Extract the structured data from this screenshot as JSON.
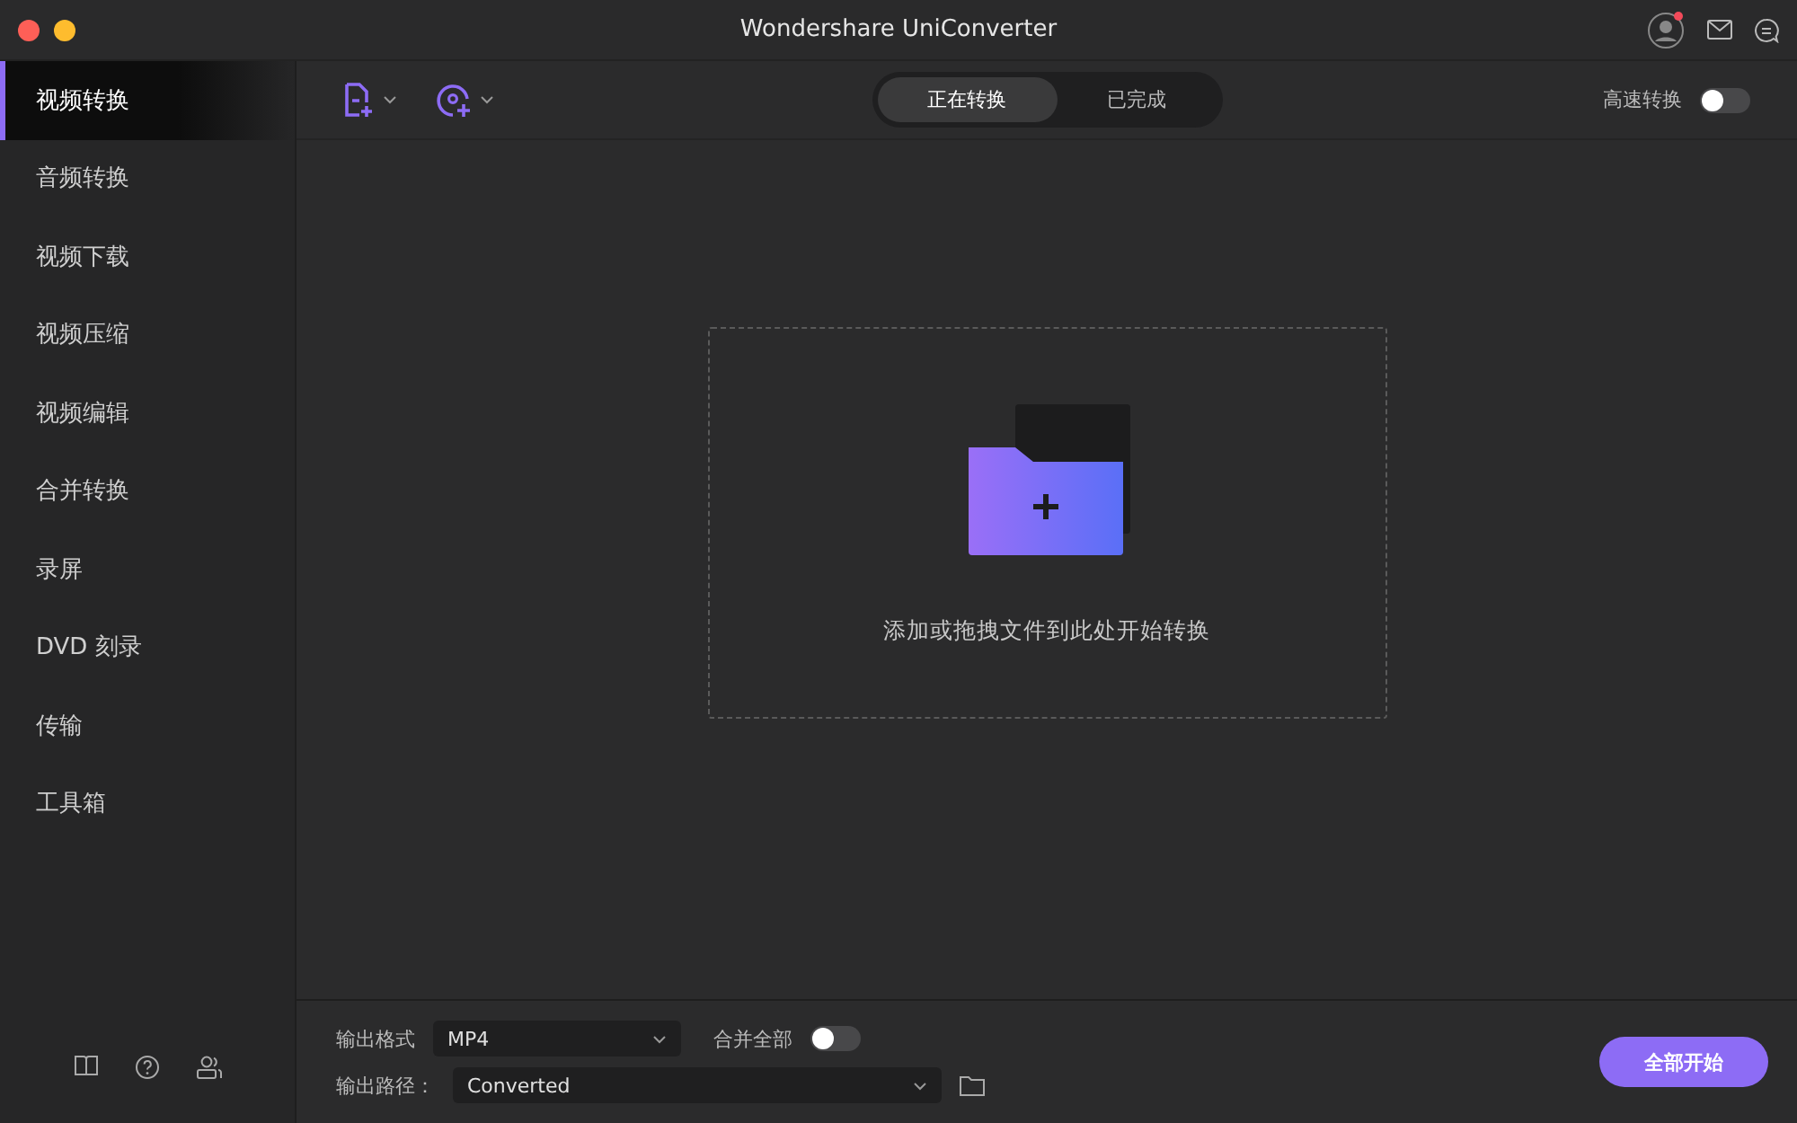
{
  "window": {
    "title": "Wondershare UniConverter",
    "has_notification": true
  },
  "sidebar": {
    "items": [
      {
        "label": "视频转换",
        "selected": true
      },
      {
        "label": "音频转换",
        "selected": false
      },
      {
        "label": "视频下载",
        "selected": false
      },
      {
        "label": "视频压缩",
        "selected": false
      },
      {
        "label": "视频编辑",
        "selected": false
      },
      {
        "label": "合并转换",
        "selected": false
      },
      {
        "label": "录屏",
        "selected": false
      },
      {
        "label": "DVD 刻录",
        "selected": false
      },
      {
        "label": "传输",
        "selected": false
      },
      {
        "label": "工具箱",
        "selected": false
      }
    ]
  },
  "tabs": [
    {
      "label": "正在转换",
      "selected": true
    },
    {
      "label": "已完成",
      "selected": false
    }
  ],
  "high_speed": {
    "label": "高速转换",
    "on": false
  },
  "drop_zone": {
    "text": "添加或拖拽文件到此处开始转换"
  },
  "output": {
    "format_label": "输出格式",
    "format": "MP4",
    "merge_label": "合并全部",
    "merge_on": false,
    "path_label": "输出路径：",
    "path": "Converted"
  },
  "start_button": "全部开始"
}
